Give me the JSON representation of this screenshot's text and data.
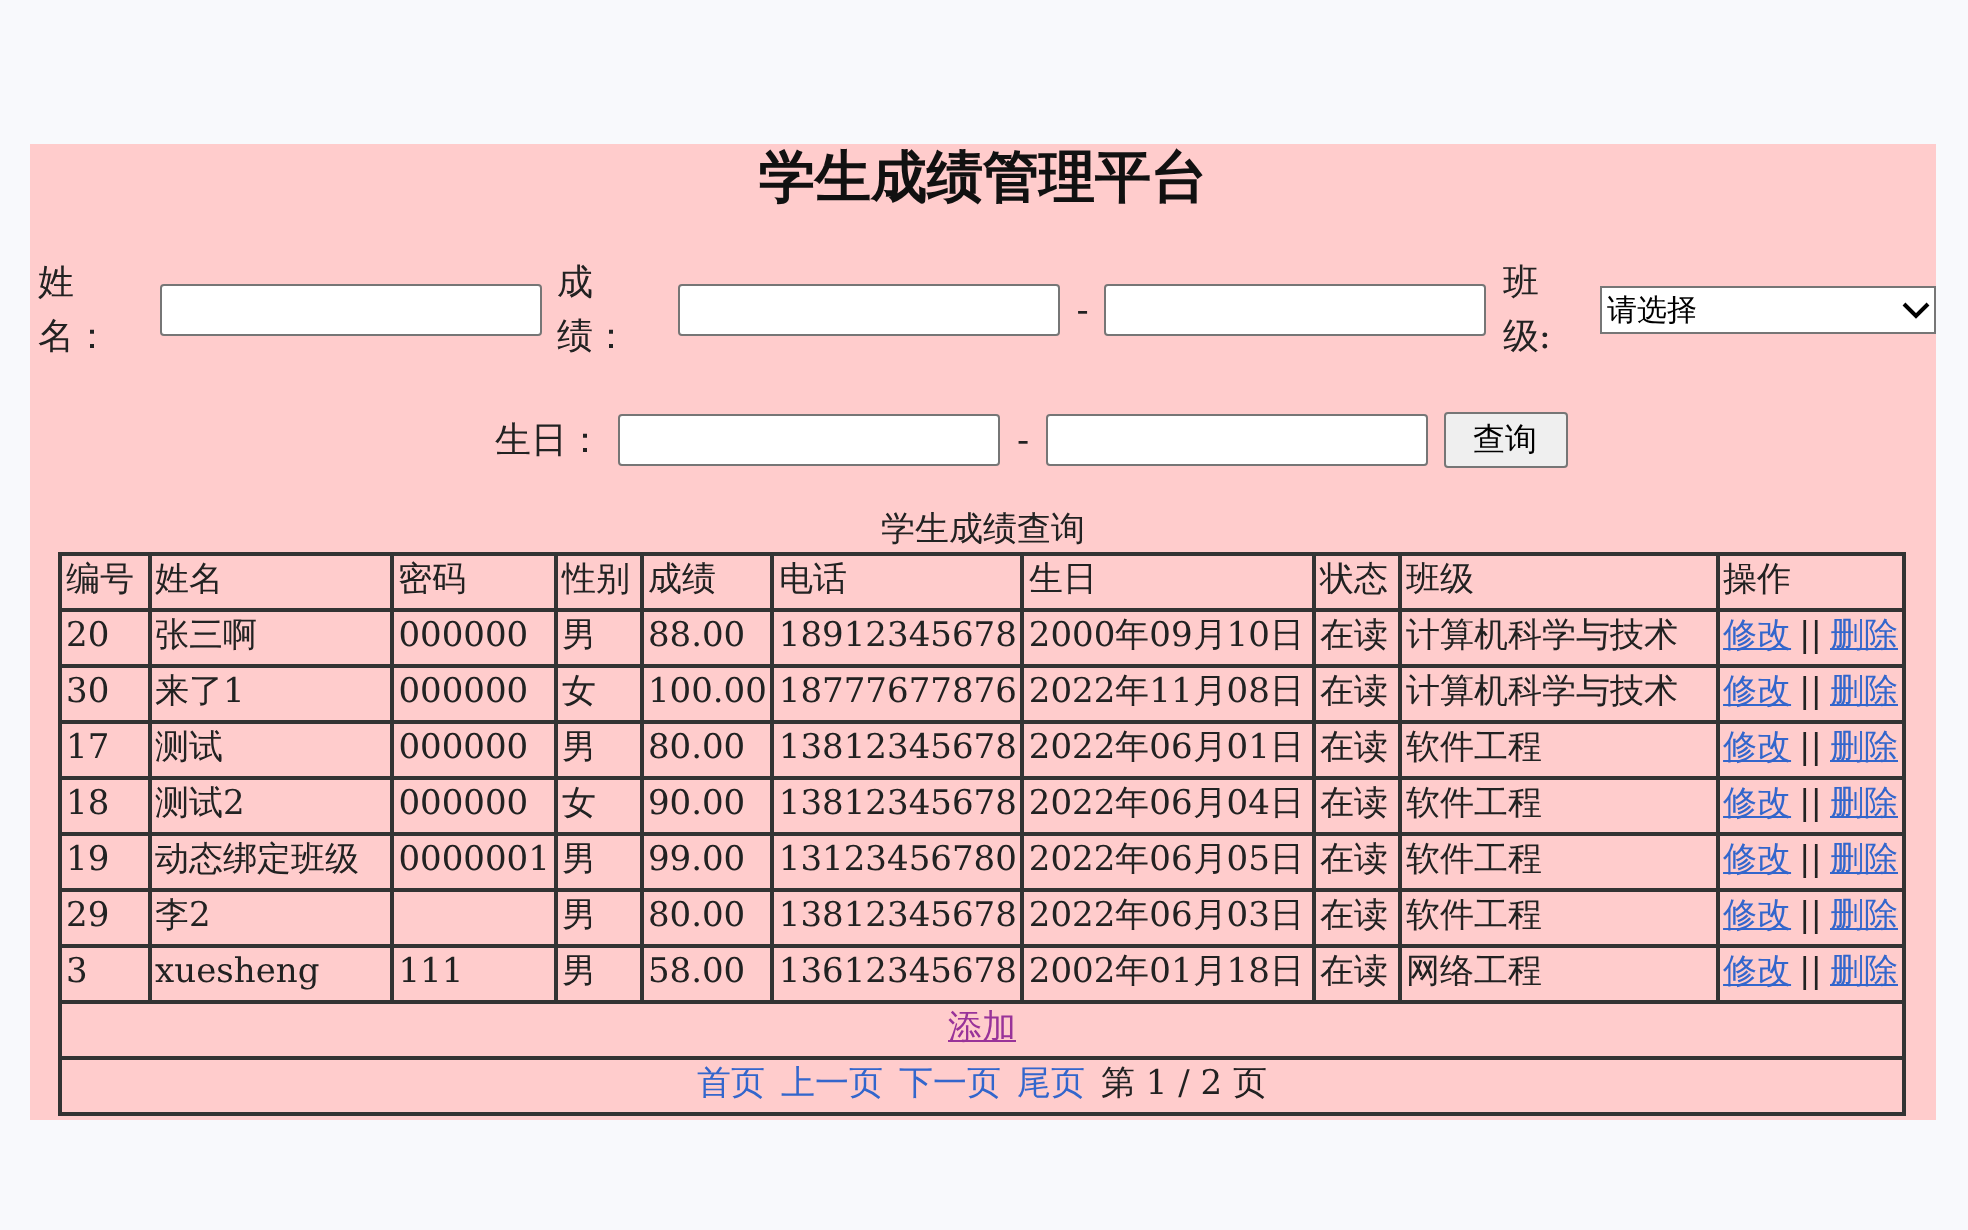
{
  "title": "学生成绩管理平台",
  "filters": {
    "name_label": "姓名：",
    "score_label": "成绩：",
    "range_dash": "-",
    "class_label": "班级:",
    "class_select": "请选择",
    "birthday_label": "生日：",
    "birthday_dash": "-",
    "query_button": "查询"
  },
  "table": {
    "caption": "学生成绩查询",
    "columns": [
      "编号",
      "姓名",
      "密码",
      "性别",
      "成绩",
      "电话",
      "生日",
      "状态",
      "班级",
      "操作"
    ],
    "rows": [
      {
        "cells": [
          "20",
          "张三啊",
          "000000",
          "男",
          "88.00",
          "18912345678",
          "2000年09月10日",
          "在读",
          "计算机科学与技术"
        ],
        "actions": [
          "修改",
          "||",
          "删除"
        ]
      },
      {
        "cells": [
          "30",
          "来了1",
          "000000",
          "女",
          "100.00",
          "18777677876",
          "2022年11月08日",
          "在读",
          "计算机科学与技术"
        ],
        "actions": [
          "修改",
          "||",
          "删除"
        ]
      },
      {
        "cells": [
          "17",
          "测试",
          "000000",
          "男",
          "80.00",
          "13812345678",
          "2022年06月01日",
          "在读",
          "软件工程"
        ],
        "actions": [
          "修改",
          "||",
          "删除"
        ]
      },
      {
        "cells": [
          "18",
          "测试2",
          "000000",
          "女",
          "90.00",
          "13812345678",
          "2022年06月04日",
          "在读",
          "软件工程"
        ],
        "actions": [
          "修改",
          "||",
          "删除"
        ]
      },
      {
        "cells": [
          "19",
          "动态绑定班级",
          "0000001",
          "男",
          "99.00",
          "13123456780",
          "2022年06月05日",
          "在读",
          "软件工程"
        ],
        "actions": [
          "修改",
          "||",
          "删除"
        ]
      },
      {
        "cells": [
          "29",
          "李2",
          "",
          "男",
          "80.00",
          "13812345678",
          "2022年06月03日",
          "在读",
          "软件工程"
        ],
        "actions": [
          "修改",
          "||",
          "删除"
        ]
      },
      {
        "cells": [
          "3",
          "xuesheng",
          "111",
          "男",
          "58.00",
          "13612345678",
          "2002年01月18日",
          "在读",
          "网络工程"
        ],
        "actions": [
          "修改",
          "||",
          "删除"
        ]
      }
    ],
    "add_link": "添加",
    "pagination": {
      "links": [
        "首页",
        "上一页",
        "下一页",
        "尾页"
      ],
      "status": "第 1 / 2 页"
    }
  }
}
